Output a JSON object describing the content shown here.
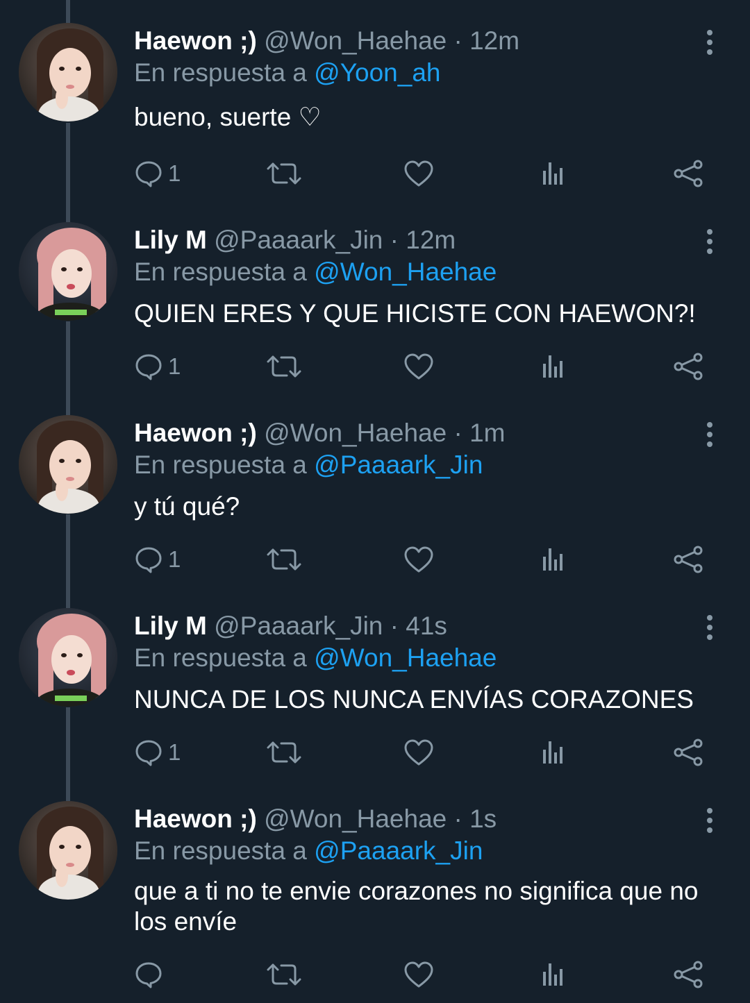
{
  "reply_prefix": "En respuesta a",
  "colors": {
    "background": "#15202b",
    "text": "#ffffff",
    "muted": "#8899a6",
    "link": "#1da1f2",
    "thread_line": "#3d4a58"
  },
  "icons": [
    "reply-icon",
    "retweet-icon",
    "like-icon",
    "analytics-icon",
    "share-icon",
    "more-icon"
  ],
  "tweets": [
    {
      "name": "Haewon ;)",
      "handle": "@Won_Haehae",
      "separator": "·",
      "time": "12m",
      "reply_to": "@Yoon_ah",
      "text": "bueno, suerte ♡",
      "reply_count": "1"
    },
    {
      "name": "Lily M",
      "handle": "@Paaaark_Jin",
      "separator": "·",
      "time": "12m",
      "reply_to": "@Won_Haehae",
      "text": "QUIEN ERES Y QUE HICISTE CON HAEWON?!",
      "reply_count": "1"
    },
    {
      "name": "Haewon ;)",
      "handle": "@Won_Haehae",
      "separator": "·",
      "time": "1m",
      "reply_to": "@Paaaark_Jin",
      "text": "y tú qué?",
      "reply_count": "1"
    },
    {
      "name": "Lily M",
      "handle": "@Paaaark_Jin",
      "separator": "·",
      "time": "41s",
      "reply_to": "@Won_Haehae",
      "text": "NUNCA DE LOS NUNCA ENVÍAS CORAZONES",
      "reply_count": "1"
    },
    {
      "name": "Haewon ;)",
      "handle": "@Won_Haehae",
      "separator": "·",
      "time": "1s",
      "reply_to": "@Paaaark_Jin",
      "text": "que a ti no te envie corazones no significa que no los envíe",
      "reply_count": ""
    }
  ]
}
